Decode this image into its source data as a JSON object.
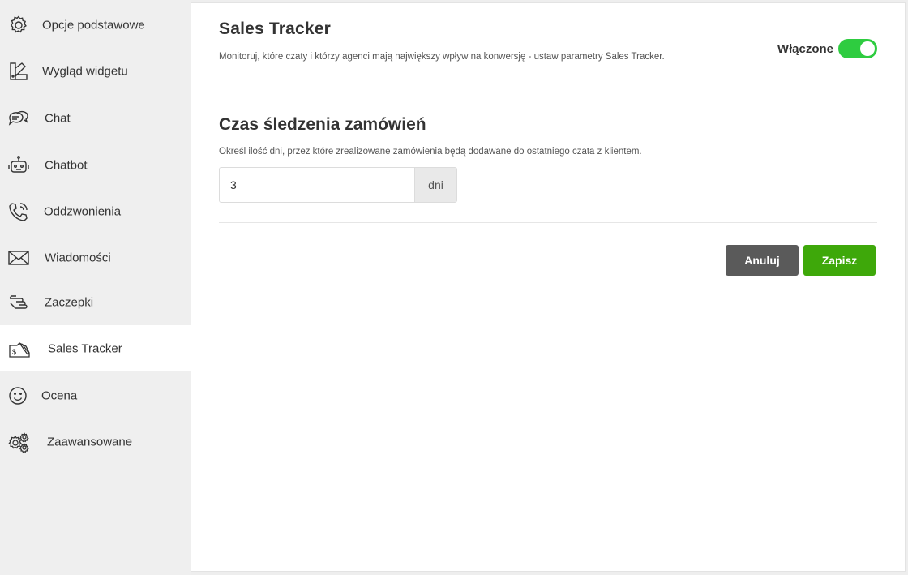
{
  "sidebar": {
    "items": [
      {
        "label": "Opcje podstawowe",
        "icon": "gear-icon",
        "active": false
      },
      {
        "label": "Wygląd widgetu",
        "icon": "palette-icon",
        "active": false
      },
      {
        "label": "Chat",
        "icon": "chat-bubbles-icon",
        "active": false
      },
      {
        "label": "Chatbot",
        "icon": "robot-icon",
        "active": false
      },
      {
        "label": "Oddzwonienia",
        "icon": "phone-icon",
        "active": false
      },
      {
        "label": "Wiadomości",
        "icon": "envelope-icon",
        "active": false
      },
      {
        "label": "Zaczepki",
        "icon": "hand-icon",
        "active": false
      },
      {
        "label": "Sales Tracker",
        "icon": "money-tag-icon",
        "active": true
      },
      {
        "label": "Ocena",
        "icon": "smiley-icon",
        "active": false
      },
      {
        "label": "Zaawansowane",
        "icon": "gears-icon",
        "active": false
      }
    ]
  },
  "main": {
    "title": "Sales Tracker",
    "description": "Monitoruj, które czaty i którzy agenci mają największy wpływ na konwersję - ustaw parametry Sales Tracker.",
    "toggle": {
      "label": "Włączone",
      "on": true,
      "color": "#2ecc40"
    },
    "section": {
      "title": "Czas śledzenia zamówień",
      "description": "Określ ilość dni, przez które zrealizowane zamówienia będą dodawane do ostatniego czata z klientem.",
      "input_value": "3",
      "input_suffix": "dni"
    },
    "buttons": {
      "cancel": "Anuluj",
      "save": "Zapisz"
    }
  },
  "colors": {
    "accent": "#3ea80a",
    "toggle_on": "#2ecc40",
    "cancel_bg": "#5a5a5a"
  }
}
